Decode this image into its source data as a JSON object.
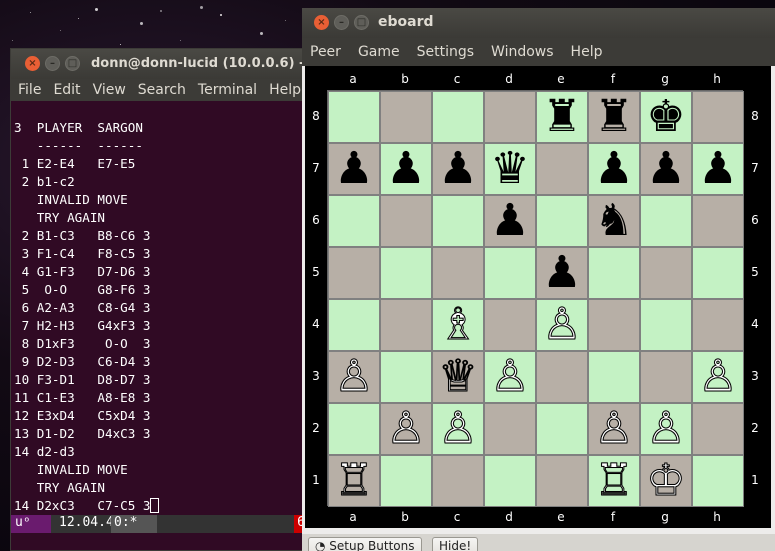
{
  "terminal": {
    "title": "donn@donn-lucid (10.0.0.6) - b",
    "menu": [
      "File",
      "Edit",
      "View",
      "Search",
      "Terminal",
      "Help"
    ],
    "lines": [
      "3  PLAYER  SARGON",
      "   ------  ------",
      " 1 E2-E4   E7-E5",
      " 2 b1-c2",
      "   INVALID MOVE",
      "   TRY AGAIN",
      " 2 B1-C3   B8-C6 3",
      " 3 F1-C4   F8-C5 3",
      " 4 G1-F3   D7-D6 3",
      " 5  O-O    G8-F6 3",
      " 6 A2-A3   C8-G4 3",
      " 7 H2-H3   G4xF3 3",
      " 8 D1xF3    O-O  3",
      " 9 D2-D3   C6-D4 3",
      "10 F3-D1   D8-D7 3",
      "11 C1-E3   A8-E8 3",
      "12 E3xD4   C5xD4 3",
      "13 D1-D2   D4xC3 3",
      "14 d2-d3",
      "   INVALID MOVE",
      "   TRY AGAIN",
      "14 D2xC3   C7-C5 3"
    ],
    "status": {
      "user": "u",
      "version": "12.04.4",
      "session": "0:*",
      "number": "6"
    }
  },
  "eboard": {
    "title": "eboard",
    "menu": [
      "Peer",
      "Game",
      "Settings",
      "Windows",
      "Help"
    ],
    "files": [
      "a",
      "b",
      "c",
      "d",
      "e",
      "f",
      "g",
      "h"
    ],
    "ranks": [
      "8",
      "7",
      "6",
      "5",
      "4",
      "3",
      "2",
      "1"
    ],
    "position": [
      [
        "",
        "",
        "",
        "",
        "♜",
        "♜",
        "♚",
        ""
      ],
      [
        "♟",
        "♟",
        "♟",
        "♛",
        "",
        "♟",
        "♟",
        "♟"
      ],
      [
        "",
        "",
        "",
        "♟",
        "",
        "♞",
        "",
        ""
      ],
      [
        "",
        "",
        "",
        "",
        "♟",
        "",
        "",
        ""
      ],
      [
        "",
        "",
        "♗",
        "",
        "♙",
        "",
        "",
        ""
      ],
      [
        "♙",
        "",
        "♕",
        "♙",
        "",
        "",
        "",
        "♙"
      ],
      [
        "",
        "♙",
        "♙",
        "",
        "",
        "♙",
        "♙",
        ""
      ],
      [
        "♖",
        "",
        "",
        "",
        "",
        "♖",
        "♔",
        ""
      ]
    ],
    "buttons": {
      "setup": "Setup Buttons",
      "hide": "Hide!"
    },
    "colors": {
      "light_square": "#c4f2c4",
      "dark_square": "#b7afa6"
    }
  }
}
